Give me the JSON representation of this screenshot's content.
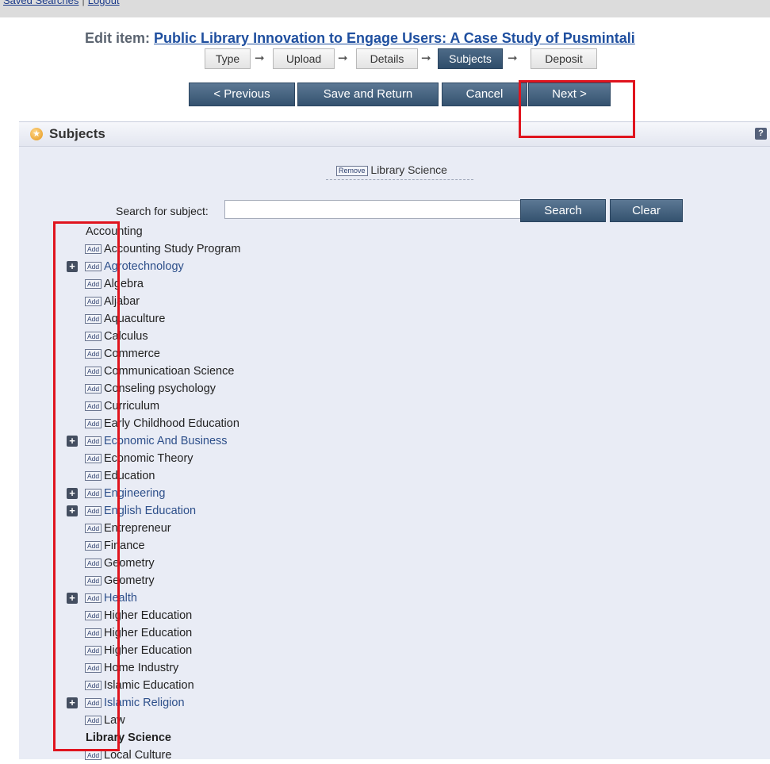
{
  "topbar": {
    "links": [
      "Saved Searches",
      "Logout"
    ]
  },
  "title": {
    "prefix": "Edit item:",
    "item": "Public Library Innovation to Engage Users: A Case Study of Pusmintali"
  },
  "steps": [
    "Type",
    "Upload",
    "Details",
    "Subjects",
    "Deposit"
  ],
  "active_step": "Subjects",
  "buttons": {
    "previous": "< Previous",
    "save": "Save and Return",
    "cancel": "Cancel",
    "next": "Next >"
  },
  "panel": {
    "title": "Subjects",
    "help": "?",
    "remove_label": "Remove",
    "selected_subject": "Library Science",
    "search_label": "Search for subject:",
    "search_value": "",
    "search_button": "Search",
    "clear_button": "Clear"
  },
  "subjects": [
    {
      "label": "Accounting",
      "add": false,
      "expand": false,
      "style": "plain"
    },
    {
      "label": "Accounting Study Program",
      "add": true,
      "expand": false,
      "style": "normal"
    },
    {
      "label": "Agrotechnology",
      "add": true,
      "expand": true,
      "style": "link"
    },
    {
      "label": "Algebra",
      "add": true,
      "expand": false,
      "style": "normal"
    },
    {
      "label": "Aljabar",
      "add": true,
      "expand": false,
      "style": "normal"
    },
    {
      "label": "Aquaculture",
      "add": true,
      "expand": false,
      "style": "normal"
    },
    {
      "label": "Calculus",
      "add": true,
      "expand": false,
      "style": "normal"
    },
    {
      "label": "Commerce",
      "add": true,
      "expand": false,
      "style": "normal"
    },
    {
      "label": "Communicatioan Science",
      "add": true,
      "expand": false,
      "style": "normal"
    },
    {
      "label": "Conseling psychology",
      "add": true,
      "expand": false,
      "style": "normal"
    },
    {
      "label": "Curriculum",
      "add": true,
      "expand": false,
      "style": "normal"
    },
    {
      "label": "Early Childhood Education",
      "add": true,
      "expand": false,
      "style": "normal"
    },
    {
      "label": "Economic And Business",
      "add": true,
      "expand": true,
      "style": "link"
    },
    {
      "label": "Economic Theory",
      "add": true,
      "expand": false,
      "style": "normal"
    },
    {
      "label": "Education",
      "add": true,
      "expand": false,
      "style": "normal"
    },
    {
      "label": "Engineering",
      "add": true,
      "expand": true,
      "style": "link"
    },
    {
      "label": "English Education",
      "add": true,
      "expand": true,
      "style": "link"
    },
    {
      "label": "Entrepreneur",
      "add": true,
      "expand": false,
      "style": "normal"
    },
    {
      "label": "Finance",
      "add": true,
      "expand": false,
      "style": "normal"
    },
    {
      "label": "Geometry",
      "add": true,
      "expand": false,
      "style": "normal"
    },
    {
      "label": "Geometry",
      "add": true,
      "expand": false,
      "style": "normal"
    },
    {
      "label": "Health",
      "add": true,
      "expand": true,
      "style": "link"
    },
    {
      "label": "Higher Education",
      "add": true,
      "expand": false,
      "style": "normal"
    },
    {
      "label": "Higher Education",
      "add": true,
      "expand": false,
      "style": "normal"
    },
    {
      "label": "Higher Education",
      "add": true,
      "expand": false,
      "style": "normal"
    },
    {
      "label": "Home Industry",
      "add": true,
      "expand": false,
      "style": "normal"
    },
    {
      "label": "Islamic Education",
      "add": true,
      "expand": false,
      "style": "normal"
    },
    {
      "label": "Islamic Religion",
      "add": true,
      "expand": true,
      "style": "link"
    },
    {
      "label": "Law",
      "add": true,
      "expand": false,
      "style": "normal"
    },
    {
      "label": "Library Science",
      "add": false,
      "expand": false,
      "style": "bold"
    },
    {
      "label": "Local Culture",
      "add": true,
      "expand": false,
      "style": "normal"
    }
  ],
  "add_label": "Add",
  "expand_symbol": "+",
  "colors": {
    "button": "#3f5d7b",
    "link": "#2d4f8a",
    "highlight": "#e0141e",
    "panel": "#e9ecf5"
  }
}
